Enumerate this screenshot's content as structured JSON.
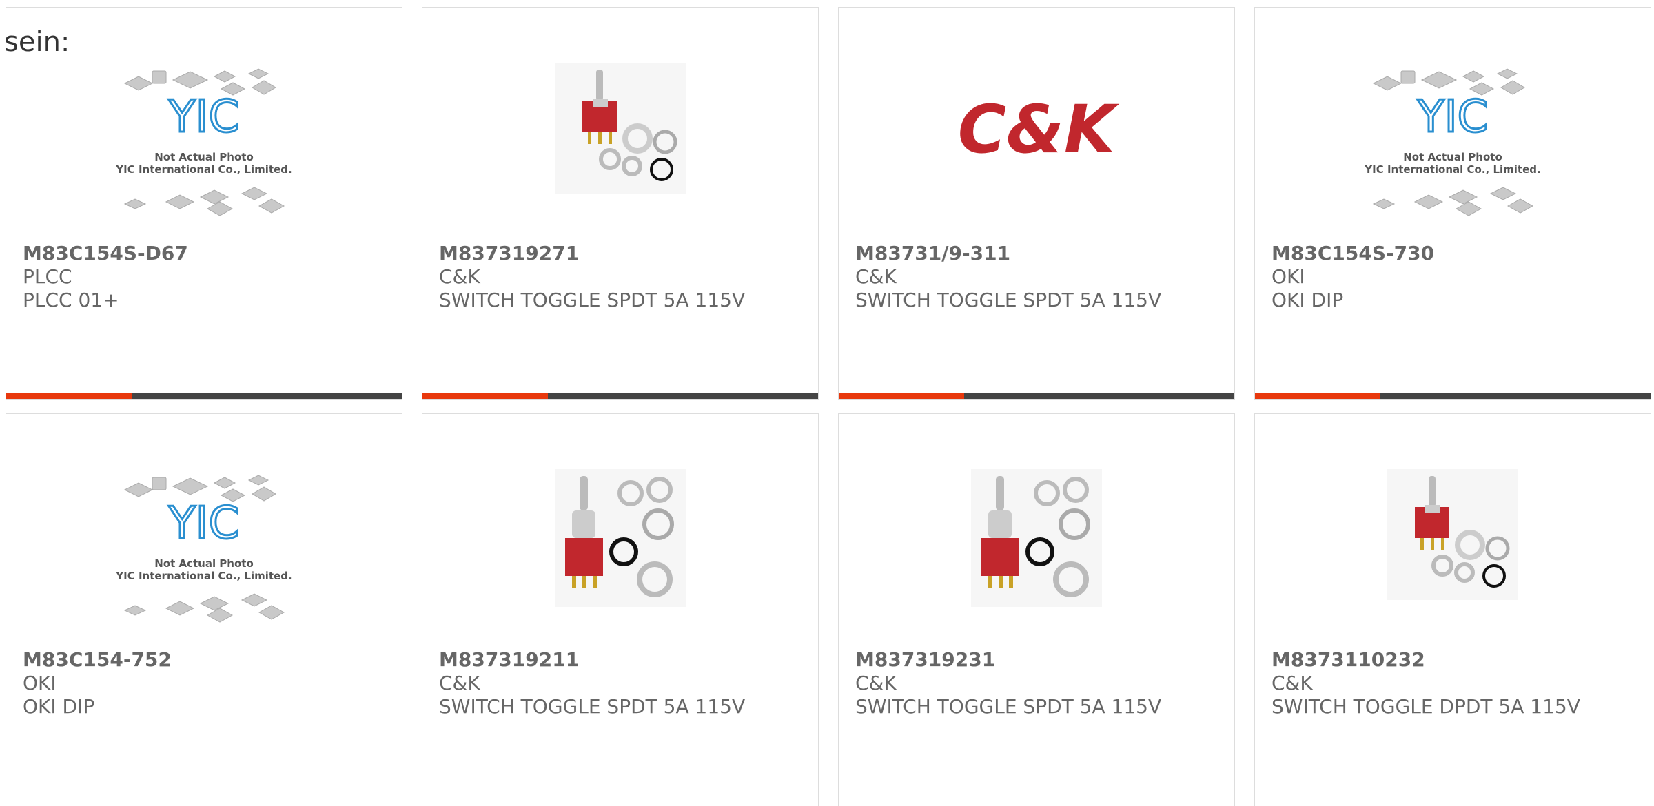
{
  "lead_text": "sein:",
  "colors": {
    "accent": "#e8380d",
    "bar": "#444444",
    "text": "#666666",
    "yic_blue": "#2a8fd0",
    "ck_red": "#c1272d"
  },
  "cards": [
    {
      "part": "M83C154S-D67",
      "mfr": "PLCC",
      "desc": "PLCC 01+",
      "image": "yic-placeholder-image",
      "yic_lines": [
        "Not Actual Photo",
        "YIC International Co., Limited."
      ]
    },
    {
      "part": "M837319271",
      "mfr": "C&K",
      "desc": "SWITCH TOGGLE SPDT 5A 115V",
      "image": "toggle-switch-image"
    },
    {
      "part": "M83731/9-311",
      "mfr": "C&K",
      "desc": "SWITCH TOGGLE SPDT 5A 115V",
      "image": "ck-logo-image",
      "logo_text": "C&K"
    },
    {
      "part": "M83C154S-730",
      "mfr": "OKI",
      "desc": "OKI DIP",
      "image": "yic-placeholder-image",
      "yic_lines": [
        "Not Actual Photo",
        "YIC International Co., Limited."
      ]
    },
    {
      "part": "M83C154-752",
      "mfr": "OKI",
      "desc": "OKI DIP",
      "image": "yic-placeholder-image",
      "yic_lines": [
        "Not Actual Photo",
        "YIC International Co., Limited."
      ]
    },
    {
      "part": "M837319211",
      "mfr": "C&K",
      "desc": "SWITCH TOGGLE SPDT 5A 115V",
      "image": "toggle-switch-image"
    },
    {
      "part": "M837319231",
      "mfr": "C&K",
      "desc": "SWITCH TOGGLE SPDT 5A 115V",
      "image": "toggle-switch-image"
    },
    {
      "part": "M8373110232",
      "mfr": "C&K",
      "desc": "SWITCH TOGGLE DPDT 5A 115V",
      "image": "toggle-switch-image"
    }
  ]
}
